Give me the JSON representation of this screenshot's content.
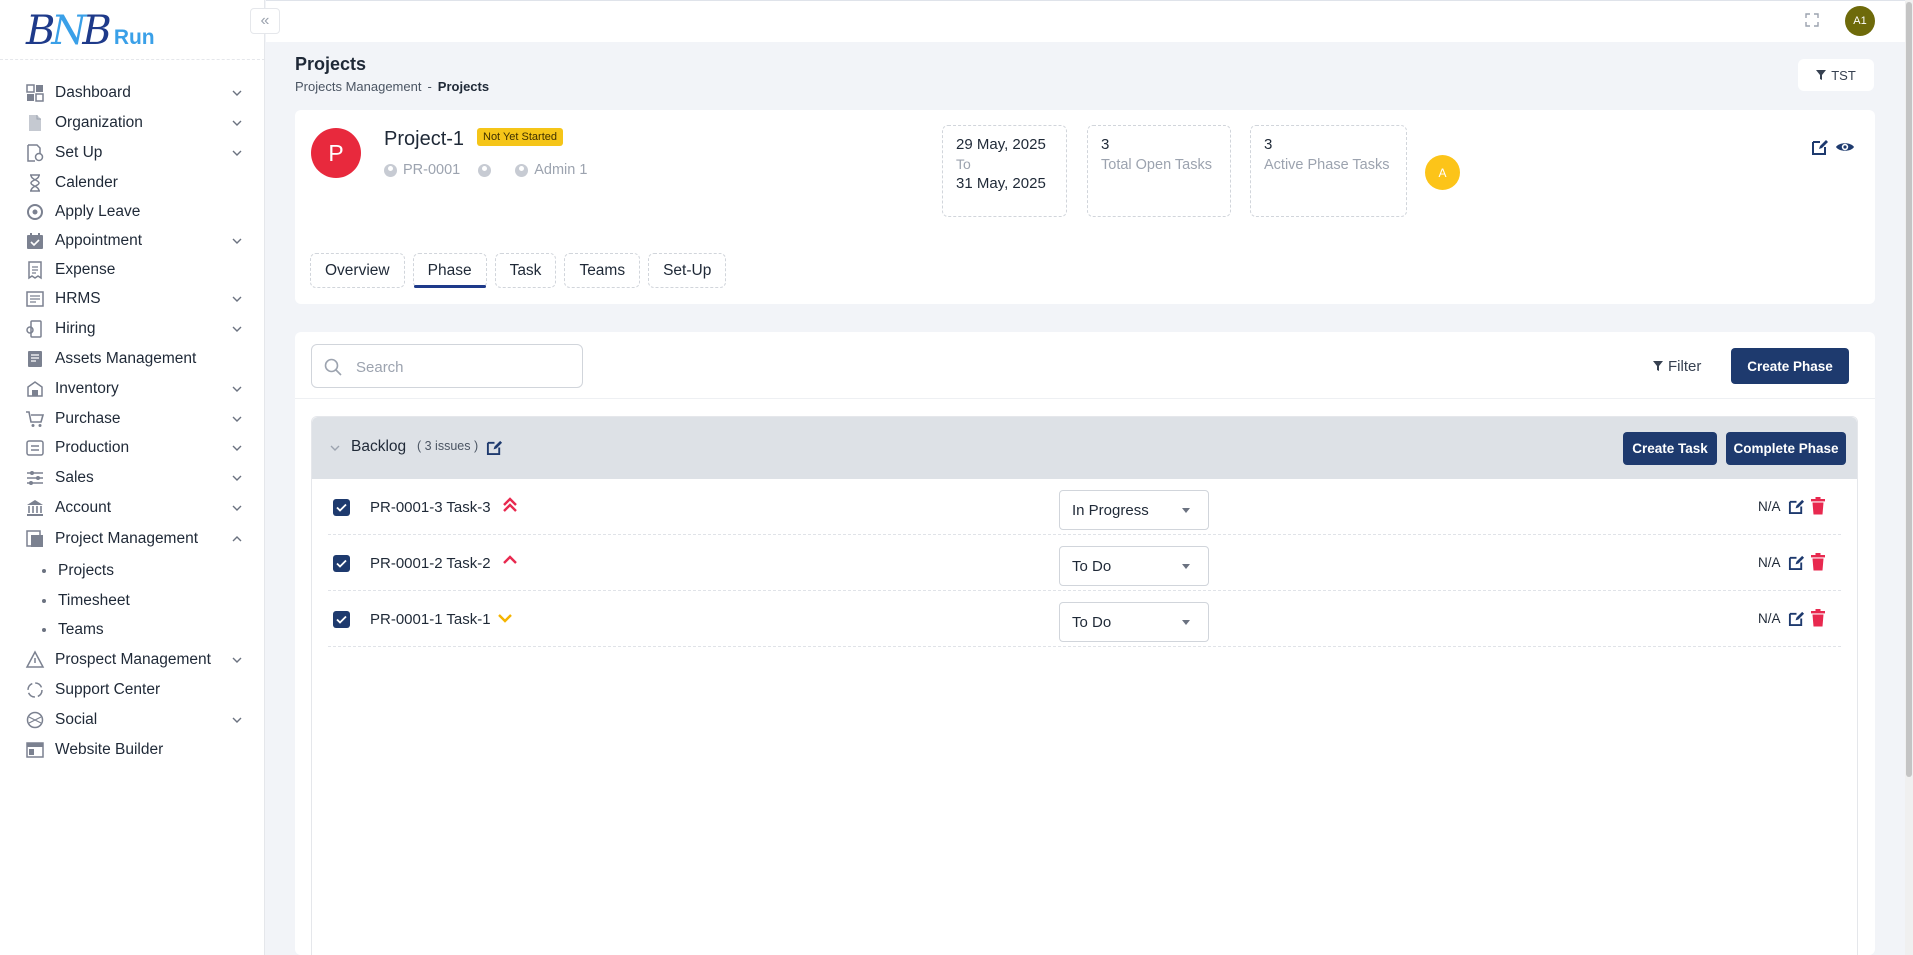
{
  "brand": {
    "logo_mark": "BNB",
    "logo_text": "Run"
  },
  "sidebar": {
    "items": [
      {
        "label": "Dashboard",
        "icon": "dashboard-icon",
        "chevron": "down"
      },
      {
        "label": "Organization",
        "icon": "document-icon",
        "chevron": "down"
      },
      {
        "label": "Set Up",
        "icon": "setup-icon",
        "chevron": "down"
      },
      {
        "label": "Calender",
        "icon": "hourglass-icon",
        "chevron": ""
      },
      {
        "label": "Apply Leave",
        "icon": "leave-icon",
        "chevron": ""
      },
      {
        "label": "Appointment",
        "icon": "calendar-check-icon",
        "chevron": "down"
      },
      {
        "label": "Expense",
        "icon": "receipt-icon",
        "chevron": ""
      },
      {
        "label": "HRMS",
        "icon": "hrms-icon",
        "chevron": "down"
      },
      {
        "label": "Hiring",
        "icon": "hiring-icon",
        "chevron": "down"
      },
      {
        "label": "Assets Management",
        "icon": "assets-icon",
        "chevron": ""
      },
      {
        "label": "Inventory",
        "icon": "inventory-icon",
        "chevron": "down"
      },
      {
        "label": "Purchase",
        "icon": "cart-icon",
        "chevron": "down"
      },
      {
        "label": "Production",
        "icon": "production-icon",
        "chevron": "down"
      },
      {
        "label": "Sales",
        "icon": "sliders-icon",
        "chevron": "down"
      },
      {
        "label": "Account",
        "icon": "bank-icon",
        "chevron": "down"
      },
      {
        "label": "Project Management",
        "icon": "project-icon",
        "chevron": "up"
      }
    ],
    "sub_items": [
      {
        "label": "Projects"
      },
      {
        "label": "Timesheet"
      },
      {
        "label": "Teams"
      }
    ],
    "items_after": [
      {
        "label": "Prospect Management",
        "icon": "prospect-icon",
        "chevron": "down"
      },
      {
        "label": "Support Center",
        "icon": "support-icon",
        "chevron": ""
      },
      {
        "label": "Social",
        "icon": "social-icon",
        "chevron": "down"
      },
      {
        "label": "Website Builder",
        "icon": "website-icon",
        "chevron": ""
      }
    ]
  },
  "topbar": {
    "user_initials": "A1",
    "collapse_glyph": "«"
  },
  "header": {
    "title": "Projects",
    "breadcrumb": [
      "Projects Management",
      "-",
      "Projects"
    ],
    "filter_tag": "TST"
  },
  "project": {
    "avatar_letter": "P",
    "name": "Project-1",
    "status": "Not Yet Started",
    "code": "PR-0001",
    "owner": "Admin 1",
    "date_from": "29 May, 2025",
    "date_to_label": "To",
    "date_to": "31 May, 2025",
    "open_tasks_count": "3",
    "open_tasks_label": "Total Open Tasks",
    "active_phase_count": "3",
    "active_phase_label": "Active Phase Tasks",
    "member_initial": "A"
  },
  "tabs": [
    {
      "label": "Overview",
      "active": false
    },
    {
      "label": "Phase",
      "active": true
    },
    {
      "label": "Task",
      "active": false
    },
    {
      "label": "Teams",
      "active": false
    },
    {
      "label": "Set-Up",
      "active": false
    }
  ],
  "phase_panel": {
    "search_placeholder": "Search",
    "filter_label": "Filter",
    "create_phase_label": "Create Phase"
  },
  "backlog": {
    "title": "Backlog",
    "count": "( 3 issues )",
    "create_task_label": "Create Task",
    "complete_phase_label": "Complete Phase",
    "tasks": [
      {
        "name": "PR-0001-3 Task-3",
        "priority": "highest",
        "status": "In Progress",
        "assignee": "N/A",
        "checked": true
      },
      {
        "name": "PR-0001-2 Task-2",
        "priority": "high",
        "status": "To Do",
        "assignee": "N/A",
        "checked": true
      },
      {
        "name": "PR-0001-1 Task-1",
        "priority": "low",
        "status": "To Do",
        "assignee": "N/A",
        "checked": true
      }
    ]
  },
  "colors": {
    "primary": "#1e3a6e",
    "danger": "#e8293d",
    "warning": "#f5c518",
    "priority_high": "#e8294f",
    "priority_low": "#f5b400"
  }
}
